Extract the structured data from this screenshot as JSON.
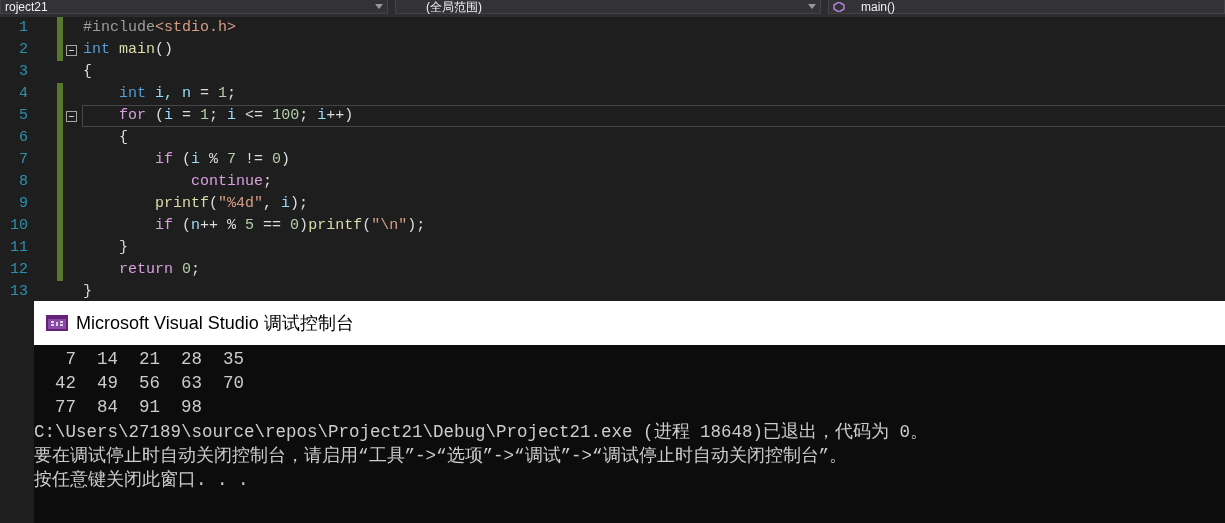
{
  "navigation_bar": {
    "project": "roject21",
    "scope": "(全局范围)",
    "member": "main()"
  },
  "editor": {
    "lines": [
      {
        "number": "1",
        "changed": true,
        "fold": false,
        "current": false,
        "tokens": [
          {
            "t": "#include",
            "kind": "pp"
          },
          {
            "t": "<stdio.h>",
            "kind": "str"
          }
        ]
      },
      {
        "number": "2",
        "changed": true,
        "fold": true,
        "current": false,
        "tokens": [
          {
            "t": "int",
            "kind": "kw"
          },
          {
            "t": " main",
            "kind": "fn"
          },
          {
            "t": "()",
            "kind": "op"
          }
        ]
      },
      {
        "number": "3",
        "changed": false,
        "fold": false,
        "current": false,
        "tokens": [
          {
            "t": "{",
            "kind": "op"
          }
        ]
      },
      {
        "number": "4",
        "changed": true,
        "fold": false,
        "current": false,
        "tokens": [
          {
            "t": "    int",
            "kind": "kw"
          },
          {
            "t": " i",
            "kind": "var"
          },
          {
            "t": ", n",
            "kind": "var"
          },
          {
            "t": " = ",
            "kind": "op"
          },
          {
            "t": "1",
            "kind": "num"
          },
          {
            "t": ";",
            "kind": "op"
          }
        ]
      },
      {
        "number": "5",
        "changed": true,
        "fold": true,
        "current": true,
        "tokens": [
          {
            "t": "    for",
            "kind": "ctl"
          },
          {
            "t": " (",
            "kind": "op"
          },
          {
            "t": "i",
            "kind": "var"
          },
          {
            "t": " = ",
            "kind": "op"
          },
          {
            "t": "1",
            "kind": "num"
          },
          {
            "t": "; ",
            "kind": "op"
          },
          {
            "t": "i",
            "kind": "var"
          },
          {
            "t": " <= ",
            "kind": "op"
          },
          {
            "t": "100",
            "kind": "num"
          },
          {
            "t": "; ",
            "kind": "op"
          },
          {
            "t": "i",
            "kind": "var"
          },
          {
            "t": "++)",
            "kind": "op"
          }
        ]
      },
      {
        "number": "6",
        "changed": true,
        "fold": false,
        "current": false,
        "tokens": [
          {
            "t": "    {",
            "kind": "op"
          }
        ]
      },
      {
        "number": "7",
        "changed": true,
        "fold": false,
        "current": false,
        "tokens": [
          {
            "t": "        if",
            "kind": "ctl"
          },
          {
            "t": " (",
            "kind": "op"
          },
          {
            "t": "i",
            "kind": "var"
          },
          {
            "t": " % ",
            "kind": "op"
          },
          {
            "t": "7",
            "kind": "num"
          },
          {
            "t": " != ",
            "kind": "op"
          },
          {
            "t": "0",
            "kind": "num"
          },
          {
            "t": ")",
            "kind": "op"
          }
        ]
      },
      {
        "number": "8",
        "changed": true,
        "fold": false,
        "current": false,
        "tokens": [
          {
            "t": "            continue",
            "kind": "ctl"
          },
          {
            "t": ";",
            "kind": "op"
          }
        ]
      },
      {
        "number": "9",
        "changed": true,
        "fold": false,
        "current": false,
        "tokens": [
          {
            "t": "        printf",
            "kind": "fn"
          },
          {
            "t": "(",
            "kind": "op"
          },
          {
            "t": "\"%4d\"",
            "kind": "str"
          },
          {
            "t": ", ",
            "kind": "op"
          },
          {
            "t": "i",
            "kind": "var"
          },
          {
            "t": ");",
            "kind": "op"
          }
        ]
      },
      {
        "number": "10",
        "changed": true,
        "fold": false,
        "current": false,
        "tokens": [
          {
            "t": "        if",
            "kind": "ctl"
          },
          {
            "t": " (",
            "kind": "op"
          },
          {
            "t": "n",
            "kind": "var"
          },
          {
            "t": "++ % ",
            "kind": "op"
          },
          {
            "t": "5",
            "kind": "num"
          },
          {
            "t": " == ",
            "kind": "op"
          },
          {
            "t": "0",
            "kind": "num"
          },
          {
            "t": ")",
            "kind": "op"
          },
          {
            "t": "printf",
            "kind": "fn"
          },
          {
            "t": "(",
            "kind": "op"
          },
          {
            "t": "\"\\n\"",
            "kind": "str"
          },
          {
            "t": ");",
            "kind": "op"
          }
        ]
      },
      {
        "number": "11",
        "changed": true,
        "fold": false,
        "current": false,
        "tokens": [
          {
            "t": "    }",
            "kind": "op"
          }
        ]
      },
      {
        "number": "12",
        "changed": true,
        "fold": false,
        "current": false,
        "tokens": [
          {
            "t": "    return",
            "kind": "ctl"
          },
          {
            "t": " 0",
            "kind": "num"
          },
          {
            "t": ";",
            "kind": "op"
          }
        ]
      },
      {
        "number": "13",
        "changed": false,
        "fold": false,
        "current": false,
        "tokens": [
          {
            "t": "}",
            "kind": "op"
          }
        ]
      }
    ]
  },
  "console": {
    "title": "Microsoft Visual Studio 调试控制台",
    "lines": [
      "   7  14  21  28  35",
      "  42  49  56  63  70",
      "  77  84  91  98",
      "C:\\Users\\27189\\source\\repos\\Project21\\Debug\\Project21.exe (进程 18648)已退出，代码为 0。",
      "要在调试停止时自动关闭控制台，请启用“工具”->“选项”->“调试”->“调试停止时自动关闭控制台”。",
      "按任意键关闭此窗口. . ."
    ]
  }
}
